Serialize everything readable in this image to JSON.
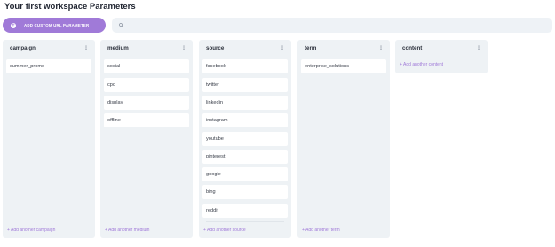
{
  "page": {
    "title": "Your first workspace Parameters"
  },
  "toolbar": {
    "add_button_label": "ADD CUSTOM URL PARAMETER",
    "search_value": "",
    "search_placeholder": ""
  },
  "columns": [
    {
      "title": "campaign",
      "items": [
        "summer_promo"
      ],
      "add_label": "+ Add another campaign"
    },
    {
      "title": "medium",
      "items": [
        "social",
        "cpc",
        "display",
        "offline"
      ],
      "add_label": "+ Add another medium"
    },
    {
      "title": "source",
      "items": [
        "facebook",
        "twitter",
        "linkedin",
        "instagram",
        "youtube",
        "pinterest",
        "google",
        "bing",
        "reddit"
      ],
      "add_label": "+ Add another source"
    },
    {
      "title": "term",
      "items": [
        "enterprise_solutions"
      ],
      "add_label": "+ Add another term"
    },
    {
      "title": "content",
      "items": [],
      "add_label": "+ Add another content"
    }
  ],
  "icons": {
    "menu": "⋮",
    "plus": "+"
  },
  "colors": {
    "accent": "#a07ad8",
    "column_bg": "#eef2f5",
    "card_bg": "#ffffff"
  }
}
